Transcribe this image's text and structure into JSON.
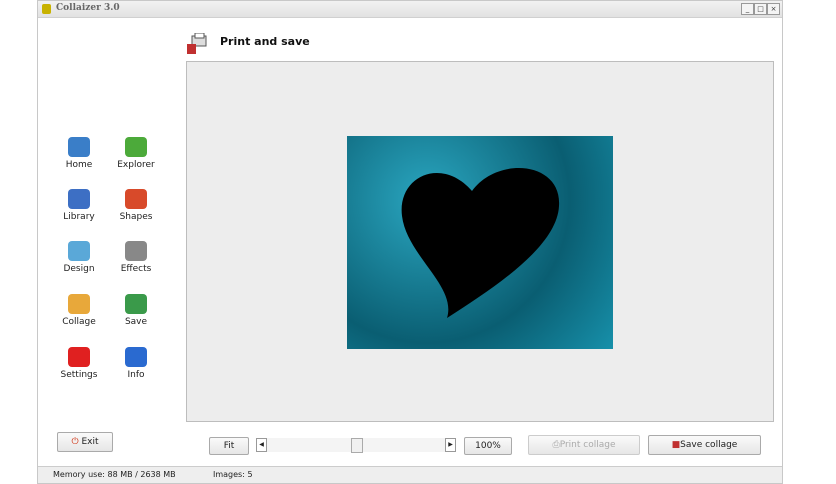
{
  "window": {
    "title": "Collaizer 3.0",
    "controls": [
      "_",
      "□",
      "×"
    ]
  },
  "header": {
    "title": "Print and save"
  },
  "sidebar": {
    "items": [
      {
        "label": "Home",
        "color": "#3a7ec8"
      },
      {
        "label": "Explorer",
        "color": "#4caa3a"
      },
      {
        "label": "Library",
        "color": "#3d6fc4"
      },
      {
        "label": "Shapes",
        "color": "#d84a2a"
      },
      {
        "label": "Design",
        "color": "#5aa8d8"
      },
      {
        "label": "Effects",
        "color": "#888888"
      },
      {
        "label": "Collage",
        "color": "#e8a83a"
      },
      {
        "label": "Save",
        "color": "#3a9a4a"
      },
      {
        "label": "Settings",
        "color": "#e02020"
      },
      {
        "label": "Info",
        "color": "#2a6ad0"
      }
    ],
    "exit": "Exit"
  },
  "toolbar": {
    "fit": "Fit",
    "zoom": "100%",
    "zoom_slider_percent": 50,
    "print": "Print collage",
    "save": "Save collage"
  },
  "status": {
    "memory": "Memory use: 88 MB / 2638 MB",
    "images": "Images: 5"
  }
}
